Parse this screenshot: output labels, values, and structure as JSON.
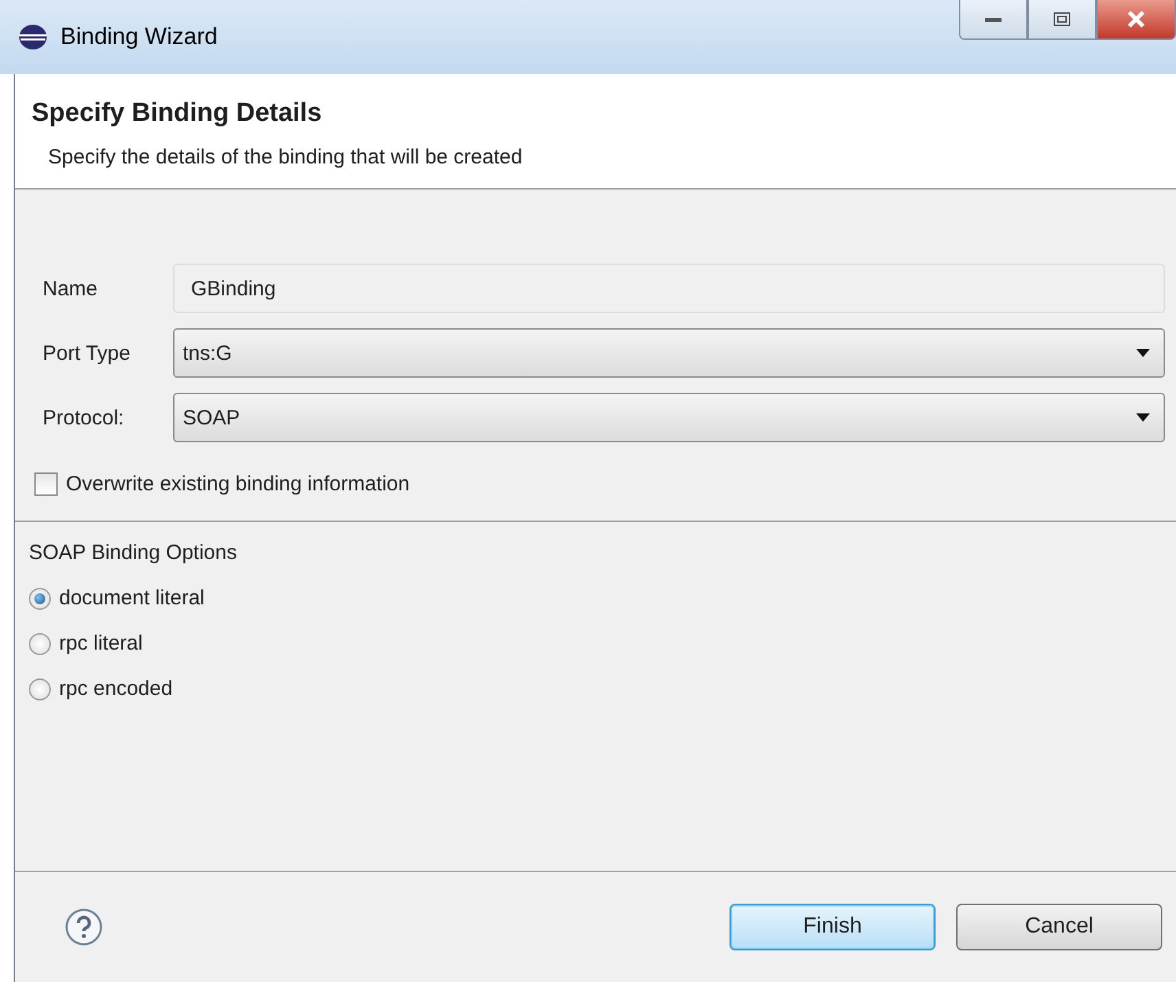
{
  "window": {
    "title": "Binding Wizard"
  },
  "header": {
    "title": "Specify Binding Details",
    "subtitle": "Specify the details of the binding that will be created"
  },
  "fields": [
    {
      "label": "Name",
      "kind": "text",
      "value": "GBinding",
      "disabled": true
    },
    {
      "label": "Port Type",
      "kind": "dropdown",
      "value": "tns:G",
      "disabled": false
    },
    {
      "label": "Protocol:",
      "kind": "dropdown",
      "value": "SOAP",
      "disabled": false
    }
  ],
  "overwrite": {
    "label": "Overwrite existing binding information",
    "checked": false
  },
  "soap_options": {
    "title": "SOAP Binding Options",
    "options": [
      {
        "label": "document literal",
        "selected": true
      },
      {
        "label": "rpc literal",
        "selected": false
      },
      {
        "label": "rpc encoded",
        "selected": false
      }
    ]
  },
  "buttons": [
    {
      "label": "Finish",
      "default": true
    },
    {
      "label": "Cancel",
      "default": false
    }
  ]
}
